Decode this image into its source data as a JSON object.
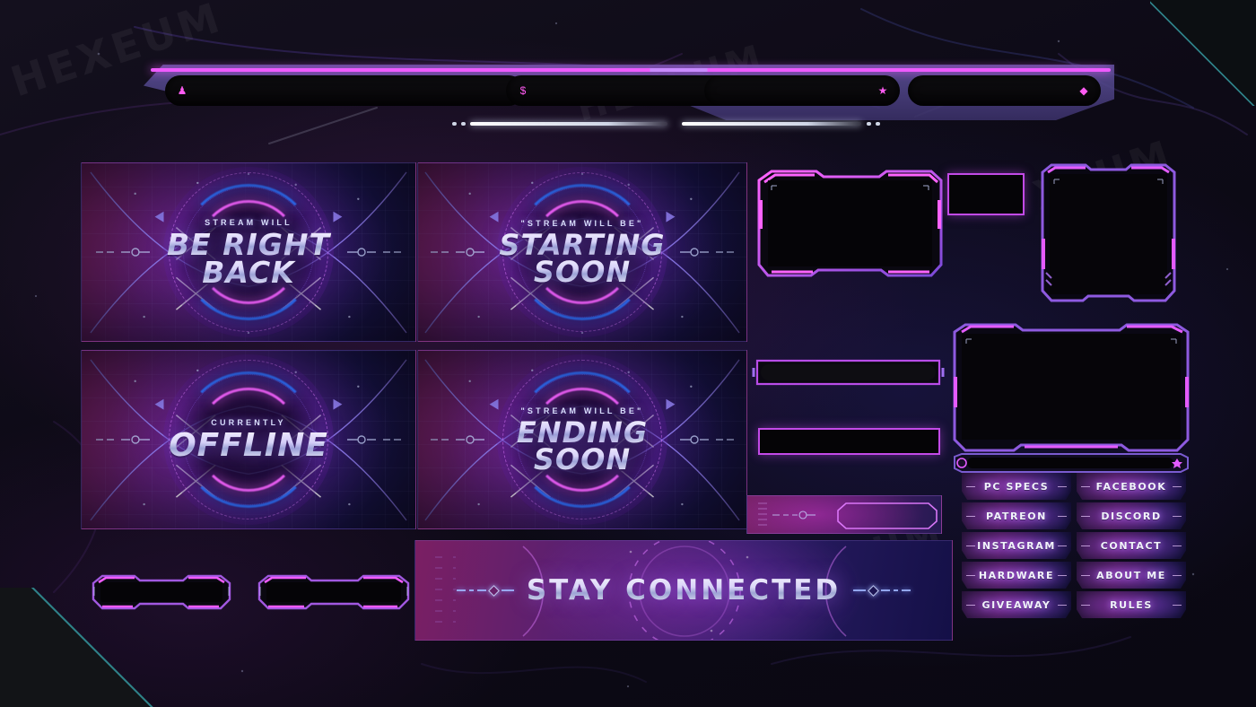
{
  "theme": {
    "accent_pink": "#ef5bff",
    "accent_purple": "#8a4fd6",
    "accent_blue": "#2f6cf5",
    "accent_teal": "#2e7f86",
    "text_light": "#f1f3fb"
  },
  "watermarks": [
    "HEXEUM",
    "HEXEUM",
    "HEX",
    "XEUM"
  ],
  "topbar": {
    "slots": [
      {
        "icon": "person-icon",
        "glyph": "♟",
        "value": ""
      },
      {
        "icon": "dollar-icon",
        "glyph": "$",
        "value": ""
      },
      {
        "icon": "star-icon",
        "glyph": "★",
        "value": ""
      },
      {
        "icon": "diamond-icon",
        "glyph": "◆",
        "value": ""
      }
    ]
  },
  "screens": [
    {
      "id": "be-right-back",
      "kicker": "STREAM WILL",
      "title_line1": "BE RIGHT",
      "title_line2": "BACK"
    },
    {
      "id": "starting-soon",
      "kicker": "\"STREAM WILL BE\"",
      "title_line1": "STARTING",
      "title_line2": "SOON"
    },
    {
      "id": "currently-offline",
      "kicker": "CURRENTLY",
      "title_line1": "OFFLINE",
      "title_line2": ""
    },
    {
      "id": "ending-soon",
      "kicker": "\"STREAM WILL BE\"",
      "title_line1": "ENDING",
      "title_line2": "SOON"
    }
  ],
  "banner": {
    "title": "STAY CONNECTED"
  },
  "panels": {
    "buttons": [
      {
        "label": "PC SPECS"
      },
      {
        "label": "FACEBOOK"
      },
      {
        "label": "PATREON"
      },
      {
        "label": "DISCORD"
      },
      {
        "label": "INSTAGRAM"
      },
      {
        "label": "CONTACT"
      },
      {
        "label": "HARDWARE"
      },
      {
        "label": "ABOUT ME"
      },
      {
        "label": "GIVEAWAY"
      },
      {
        "label": "RULES"
      }
    ]
  },
  "frames": [
    {
      "id": "webcam-wide",
      "label": ""
    },
    {
      "id": "webcam-thumb",
      "label": ""
    },
    {
      "id": "webcam-square",
      "label": ""
    },
    {
      "id": "gameplay-frame",
      "label": ""
    },
    {
      "id": "talkbar",
      "label": ""
    },
    {
      "id": "eventbar",
      "label": ""
    },
    {
      "id": "alert-strip",
      "label": ""
    },
    {
      "id": "label-box-left",
      "label": ""
    },
    {
      "id": "label-box-right",
      "label": ""
    }
  ]
}
